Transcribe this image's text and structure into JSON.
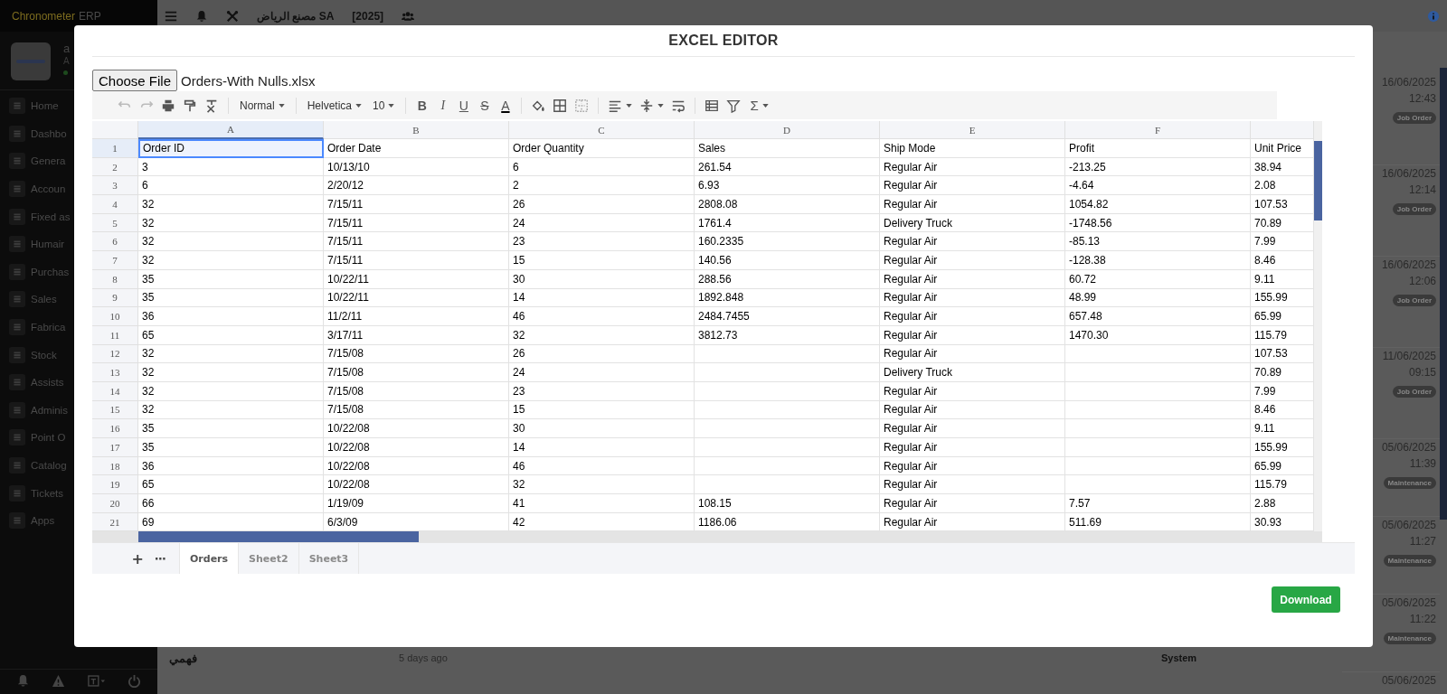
{
  "sidebar": {
    "brand": {
      "name": "Chronometer",
      "suffix": "ERP"
    },
    "user": {
      "name": "a",
      "role": "A"
    },
    "items": [
      {
        "label": "Home"
      },
      {
        "label": "Dashbo"
      },
      {
        "label": "Genera"
      },
      {
        "label": "Accoun"
      },
      {
        "label": "Fixed as"
      },
      {
        "label": "Humair"
      },
      {
        "label": "Purchas"
      },
      {
        "label": "Sales"
      },
      {
        "label": "Fabrica"
      },
      {
        "label": "Stock"
      },
      {
        "label": "Assists"
      },
      {
        "label": "Adminis"
      },
      {
        "label": "Point O"
      },
      {
        "label": "Catalog"
      },
      {
        "label": "Tickets"
      },
      {
        "label": "Apps"
      }
    ]
  },
  "top_bar": {
    "company": "مصنع الرياض SA",
    "year": "[2025]"
  },
  "activity": [
    {
      "date": "16/06/2025",
      "time": "12:43",
      "tag": "Job Order"
    },
    {
      "date": "16/06/2025",
      "time": "12:14",
      "tag": "Job Order"
    },
    {
      "date": "16/06/2025",
      "time": "12:06",
      "tag": "Job Order"
    },
    {
      "date": "11/06/2025",
      "time": "09:15",
      "tag": "Job Order"
    },
    {
      "date": "05/06/2025",
      "time": "11:39",
      "tag": "Maintenance"
    },
    {
      "date": "05/06/2025",
      "time": "11:27",
      "tag": "Maintenance"
    },
    {
      "date": "05/06/2025",
      "time": "11:22",
      "tag": "Maintenance"
    },
    {
      "date": "05/06/2025"
    }
  ],
  "footer_row": {
    "name": "فهمي",
    "when": "5 days ago",
    "source": "System"
  },
  "dialog": {
    "title": "EXCEL EDITOR",
    "file_button": "Choose File",
    "file_name": "Orders-With Nulls.xlsx",
    "toolbar": {
      "style": "Normal",
      "font": "Helvetica",
      "size": "10",
      "sum": "Σ",
      "format_buttons": [
        {
          "kind": "bold",
          "glyph": "B"
        },
        {
          "kind": "italic",
          "glyph": "I"
        },
        {
          "kind": "underline",
          "glyph": "U"
        },
        {
          "kind": "strike",
          "glyph": "S"
        },
        {
          "kind": "color",
          "glyph": "A"
        }
      ]
    },
    "columns": [
      {
        "label": "A",
        "selected": true
      },
      {
        "label": "B",
        "selected": false
      },
      {
        "label": "C",
        "selected": false
      },
      {
        "label": "D",
        "selected": false
      },
      {
        "label": "E",
        "selected": false
      },
      {
        "label": "F",
        "selected": false
      }
    ],
    "rows": [
      {
        "number": "1",
        "selected": true,
        "cells": [
          "Order ID",
          "Order Date",
          "Order Quantity",
          "Sales",
          "Ship Mode",
          "Profit",
          "Unit Price"
        ]
      },
      {
        "number": "2",
        "selected": false,
        "cells": [
          "3",
          "10/13/10",
          "6",
          "261.54",
          "Regular Air",
          "-213.25",
          "38.94"
        ]
      },
      {
        "number": "3",
        "selected": false,
        "cells": [
          "6",
          "2/20/12",
          "2",
          "6.93",
          "Regular Air",
          "-4.64",
          "2.08"
        ]
      },
      {
        "number": "4",
        "selected": false,
        "cells": [
          "32",
          "7/15/11",
          "26",
          "2808.08",
          "Regular Air",
          "1054.82",
          "107.53"
        ]
      },
      {
        "number": "5",
        "selected": false,
        "cells": [
          "32",
          "7/15/11",
          "24",
          "1761.4",
          "Delivery Truck",
          "-1748.56",
          "70.89"
        ]
      },
      {
        "number": "6",
        "selected": false,
        "cells": [
          "32",
          "7/15/11",
          "23",
          "160.2335",
          "Regular Air",
          "-85.13",
          "7.99"
        ]
      },
      {
        "number": "7",
        "selected": false,
        "cells": [
          "32",
          "7/15/11",
          "15",
          "140.56",
          "Regular Air",
          "-128.38",
          "8.46"
        ]
      },
      {
        "number": "8",
        "selected": false,
        "cells": [
          "35",
          "10/22/11",
          "30",
          "288.56",
          "Regular Air",
          "60.72",
          "9.11"
        ]
      },
      {
        "number": "9",
        "selected": false,
        "cells": [
          "35",
          "10/22/11",
          "14",
          "1892.848",
          "Regular Air",
          "48.99",
          "155.99"
        ]
      },
      {
        "number": "10",
        "selected": false,
        "cells": [
          "36",
          "11/2/11",
          "46",
          "2484.7455",
          "Regular Air",
          "657.48",
          "65.99"
        ]
      },
      {
        "number": "11",
        "selected": false,
        "cells": [
          "65",
          "3/17/11",
          "32",
          "3812.73",
          "Regular Air",
          "1470.30",
          "115.79"
        ]
      },
      {
        "number": "12",
        "selected": false,
        "cells": [
          "32",
          "7/15/08",
          "26",
          null,
          "Regular Air",
          null,
          "107.53"
        ]
      },
      {
        "number": "13",
        "selected": false,
        "cells": [
          "32",
          "7/15/08",
          "24",
          null,
          "Delivery Truck",
          null,
          "70.89"
        ]
      },
      {
        "number": "14",
        "selected": false,
        "cells": [
          "32",
          "7/15/08",
          "23",
          null,
          "Regular Air",
          null,
          "7.99"
        ]
      },
      {
        "number": "15",
        "selected": false,
        "cells": [
          "32",
          "7/15/08",
          "15",
          null,
          "Regular Air",
          null,
          "8.46"
        ]
      },
      {
        "number": "16",
        "selected": false,
        "cells": [
          "35",
          "10/22/08",
          "30",
          null,
          "Regular Air",
          null,
          "9.11"
        ]
      },
      {
        "number": "17",
        "selected": false,
        "cells": [
          "35",
          "10/22/08",
          "14",
          null,
          "Regular Air",
          null,
          "155.99"
        ]
      },
      {
        "number": "18",
        "selected": false,
        "cells": [
          "36",
          "10/22/08",
          "46",
          null,
          "Regular Air",
          null,
          "65.99"
        ]
      },
      {
        "number": "19",
        "selected": false,
        "cells": [
          "65",
          "10/22/08",
          "32",
          null,
          "Regular Air",
          null,
          "115.79"
        ]
      },
      {
        "number": "20",
        "selected": false,
        "cells": [
          "66",
          "1/19/09",
          "41",
          "108.15",
          "Regular Air",
          "7.57",
          "2.88"
        ]
      },
      {
        "number": "21",
        "selected": false,
        "cells": [
          "69",
          "6/3/09",
          "42",
          "1186.06",
          "Regular Air",
          "511.69",
          "30.93"
        ]
      }
    ],
    "add_sheet": "+",
    "sheet_menu": "⋯",
    "sheet_tabs": [
      {
        "label": "Orders",
        "selected": true
      },
      {
        "label": "Sheet2",
        "selected": false
      },
      {
        "label": "Sheet3",
        "selected": false
      }
    ],
    "download": "Download"
  }
}
